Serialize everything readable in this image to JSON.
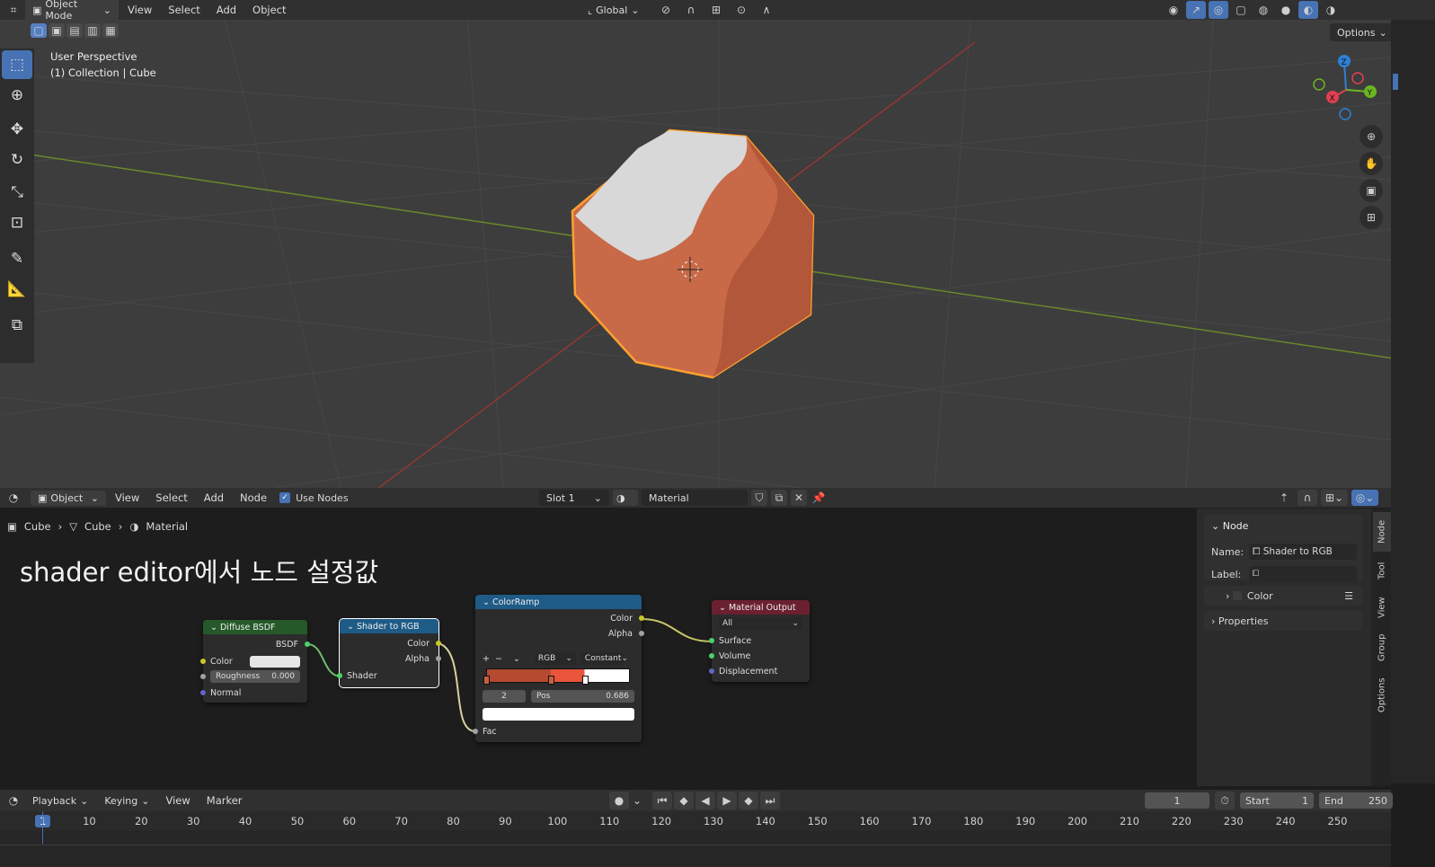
{
  "viewport_header": {
    "mode": "Object Mode",
    "menus": [
      "View",
      "Select",
      "Add",
      "Object"
    ],
    "orientation": "Global",
    "options": "Options"
  },
  "viewport": {
    "info_line1": "User Perspective",
    "info_line2": "(1) Collection | Cube"
  },
  "node_header": {
    "editor_type": "Object",
    "menus": [
      "View",
      "Select",
      "Add",
      "Node"
    ],
    "use_nodes": "Use Nodes",
    "slot": "Slot 1",
    "material": "Material"
  },
  "breadcrumb": {
    "obj": "Cube",
    "mesh": "Cube",
    "mat": "Material"
  },
  "annotation": "shader editor에서 노드 설정값",
  "nodes": {
    "diffuse": {
      "title": "Diffuse BSDF",
      "out": "BSDF",
      "color": "Color",
      "roughness_label": "Roughness",
      "roughness_value": "0.000",
      "normal": "Normal"
    },
    "s2rgb": {
      "title": "Shader to RGB",
      "color": "Color",
      "alpha": "Alpha",
      "shader": "Shader"
    },
    "ramp": {
      "title": "ColorRamp",
      "color": "Color",
      "alpha": "Alpha",
      "mode": "RGB",
      "interp": "Constant",
      "index": "2",
      "pos_label": "Pos",
      "pos_value": "0.686",
      "fac": "Fac",
      "stops": [
        0.0,
        0.45,
        0.686
      ]
    },
    "output": {
      "title": "Material Output",
      "target": "All",
      "surface": "Surface",
      "volume": "Volume",
      "displacement": "Displacement"
    }
  },
  "npanel": {
    "section": "Node",
    "name_label": "Name:",
    "name_value": "Shader to RGB",
    "label_label": "Label:",
    "color": "Color",
    "properties": "Properties",
    "tabs": [
      "Node",
      "Tool",
      "View",
      "Group",
      "Options"
    ]
  },
  "timeline": {
    "menus": [
      "Playback",
      "Keying",
      "View",
      "Marker"
    ],
    "current": "1",
    "start_label": "Start",
    "start": "1",
    "end_label": "End",
    "end": "250",
    "ticks": [
      "1",
      "10",
      "20",
      "30",
      "40",
      "50",
      "60",
      "70",
      "80",
      "90",
      "100",
      "110",
      "120",
      "130",
      "140",
      "150",
      "160",
      "170",
      "180",
      "190",
      "200",
      "210",
      "220",
      "230",
      "240",
      "250"
    ]
  },
  "colors": {
    "accent": "#4772b3",
    "object": "#c7613f",
    "selection": "#ffa030",
    "diffuse_header": "#26592a",
    "converter_header": "#1e5b87",
    "output_header": "#6b2030"
  }
}
